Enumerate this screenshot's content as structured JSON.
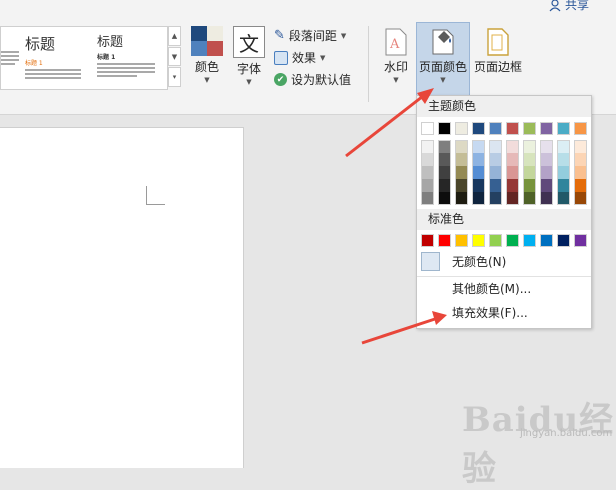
{
  "header": {
    "share_label": "共享"
  },
  "style_gallery": {
    "items": [
      {
        "title": "",
        "sub": "",
        "variant": "cut"
      },
      {
        "title": "标题",
        "sub": "标题 1",
        "variant": "orange"
      },
      {
        "title": "标题",
        "sub": "标题 1",
        "variant": "plain"
      }
    ]
  },
  "ribbon": {
    "colors_label": "颜色",
    "fonts_label": "字体",
    "fonts_glyph": "文",
    "paragraph_spacing_label": "段落间距",
    "effects_label": "效果",
    "set_default_label": "设为默认值",
    "watermark_label": "水印",
    "page_color_label": "页面颜色",
    "page_borders_label": "页面边框"
  },
  "dropdown": {
    "theme_colors_header": "主题颜色",
    "standard_colors_header": "标准色",
    "no_color_label": "无颜色(N)",
    "more_colors_label": "其他颜色(M)...",
    "fill_effects_label": "填充效果(F)...",
    "theme_colors": [
      "#ffffff",
      "#000000",
      "#eeece1",
      "#1f497d",
      "#4f81bd",
      "#c0504d",
      "#9bbb59",
      "#8064a2",
      "#4bacc6",
      "#f79646"
    ],
    "theme_shades": [
      [
        "#f2f2f2",
        "#d9d9d9",
        "#bfbfbf",
        "#a6a6a6",
        "#7f7f7f"
      ],
      [
        "#7f7f7f",
        "#595959",
        "#404040",
        "#262626",
        "#0d0d0d"
      ],
      [
        "#ddd9c4",
        "#c4bd97",
        "#948a54",
        "#4a452a",
        "#1e1c11"
      ],
      [
        "#c6d9f1",
        "#8db3e2",
        "#548dd4",
        "#17375e",
        "#0f243e"
      ],
      [
        "#dbe5f1",
        "#b8cce4",
        "#95b3d7",
        "#366092",
        "#244061"
      ],
      [
        "#f2dcdb",
        "#e6b9b8",
        "#d99694",
        "#953735",
        "#632523"
      ],
      [
        "#ebf1de",
        "#d7e4bd",
        "#c3d69b",
        "#77933c",
        "#4f6228"
      ],
      [
        "#e6e0ec",
        "#ccc1da",
        "#b3a2c7",
        "#604a7b",
        "#403152"
      ],
      [
        "#dbeef4",
        "#b7dee8",
        "#93cddd",
        "#31859c",
        "#215968"
      ],
      [
        "#fdeada",
        "#fcd5b5",
        "#fac090",
        "#e46c0a",
        "#984807"
      ]
    ],
    "standard_colors": [
      "#c00000",
      "#ff0000",
      "#ffc000",
      "#ffff00",
      "#92d050",
      "#00b050",
      "#00b0f0",
      "#0070c0",
      "#002060",
      "#7030a0"
    ]
  },
  "watermark": {
    "text": "Baidu经验",
    "sub": "jingyan.baidu.com"
  }
}
